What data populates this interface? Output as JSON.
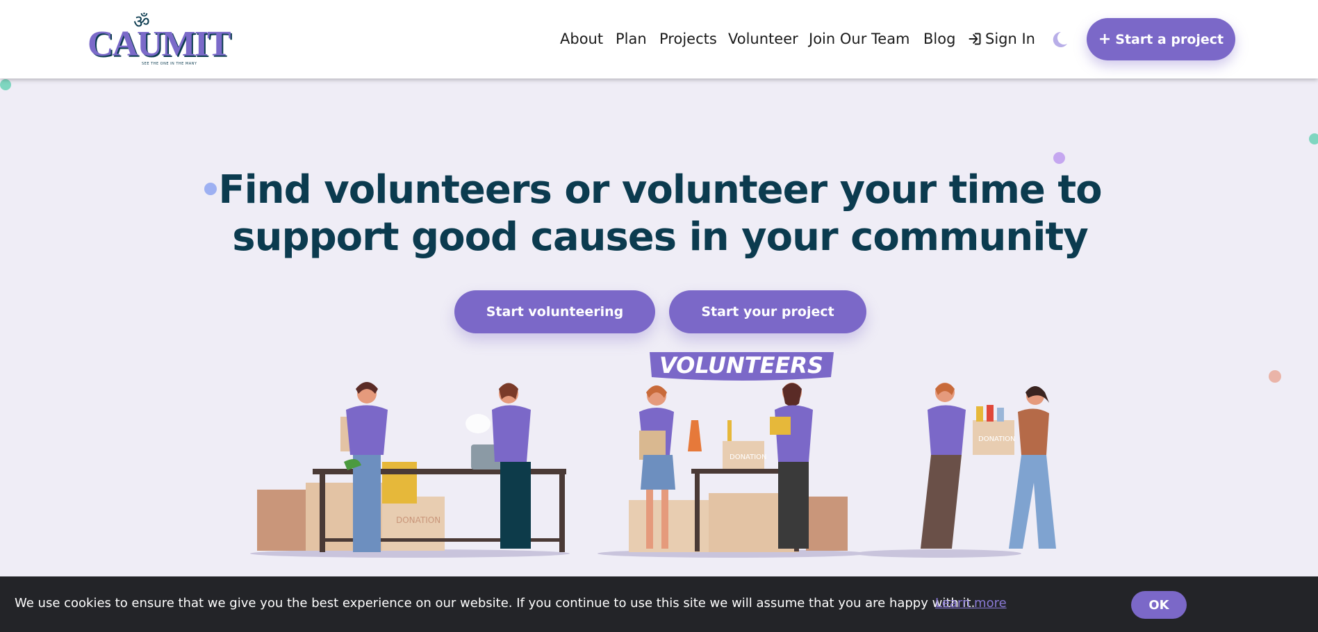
{
  "logo": {
    "om": "ॐ",
    "word": "CAUMIT",
    "tagline": "SEE THE ONE IN THE MANY"
  },
  "nav": {
    "items": [
      {
        "label": "About"
      },
      {
        "label": "Plan"
      },
      {
        "label": "Projects"
      },
      {
        "label": "Volunteer"
      },
      {
        "label": "Join Our Team"
      },
      {
        "label": "Blog"
      }
    ],
    "signin_label": "Sign In",
    "cta_label": "Start a project",
    "icons": [
      "sign-in-icon",
      "moon-icon",
      "plus-icon"
    ]
  },
  "hero": {
    "title_line1": "Find volunteers or volunteer your time to",
    "title_line2": "support good causes in your community",
    "btn_volunteer": "Start volunteering",
    "btn_project": "Start your project",
    "banner": "VOLUNTEERS",
    "box_label": "DONATION"
  },
  "cookie": {
    "text": "We use cookies to ensure that we give you the best experience on our website. If you continue to use this site we will assume that you are happy with it.",
    "link": "Learn more",
    "ok": "OK"
  },
  "colors": {
    "accent": "#7b68c8",
    "heading": "#0b3b4f",
    "background": "#efedf6",
    "cookie_bg": "#232428"
  }
}
